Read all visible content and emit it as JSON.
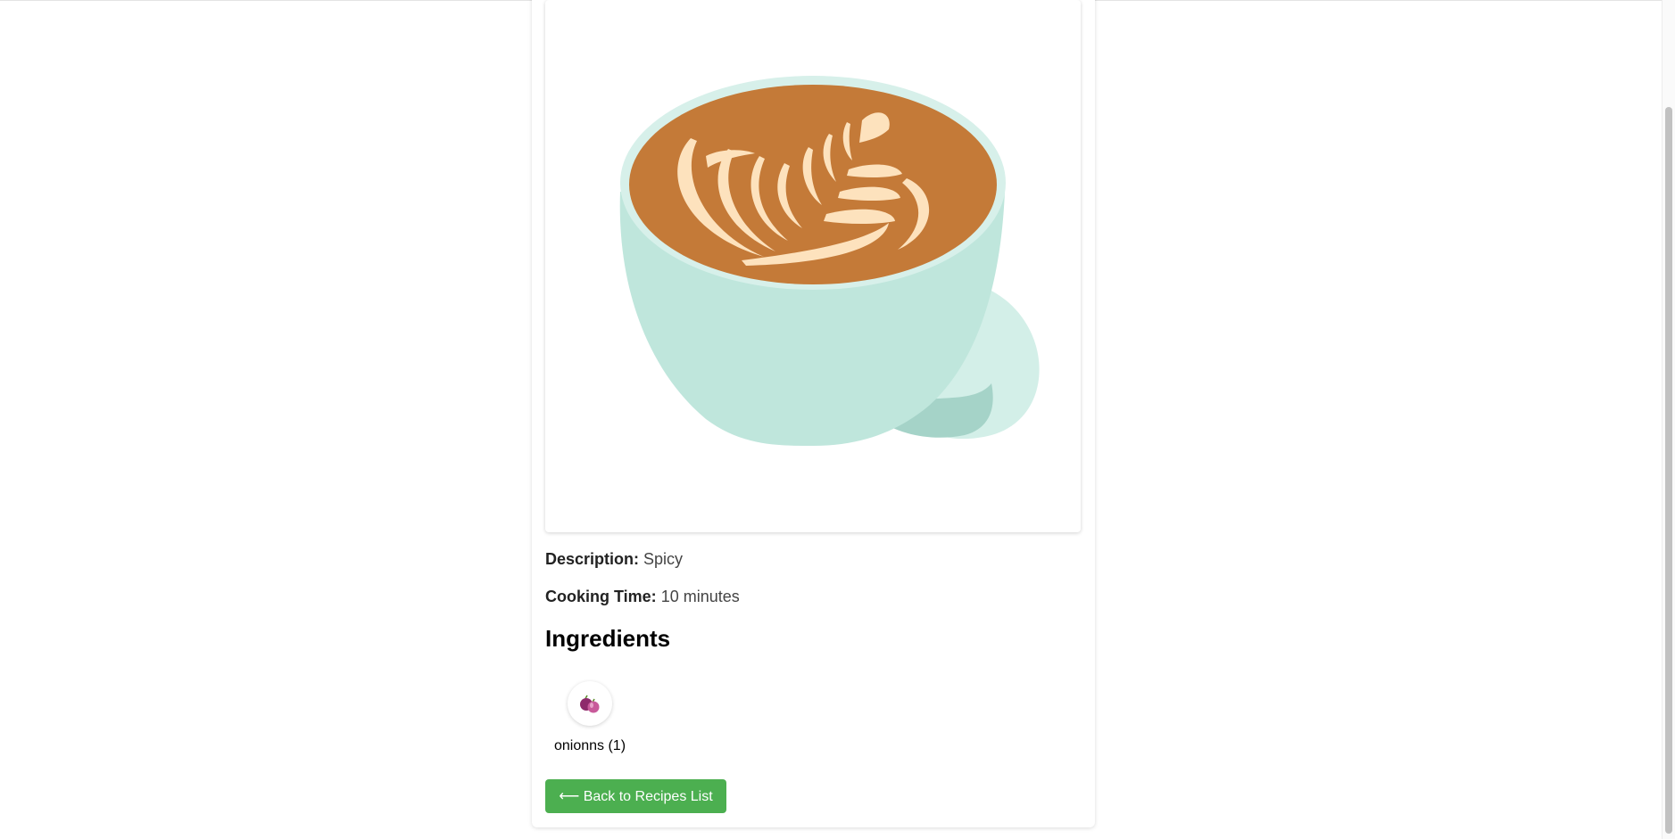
{
  "recipe": {
    "image_icon": "latte-art-coffee-cup-image",
    "description_label": "Description:",
    "description_value": "Spicy",
    "cooking_time_label": "Cooking Time:",
    "cooking_time_value": "10 minutes"
  },
  "ingredients_section": {
    "heading": "Ingredients",
    "items": [
      {
        "icon": "onion-icon",
        "label": "onionns (1)"
      }
    ]
  },
  "actions": {
    "back_label": "⟵ Back to Recipes List"
  },
  "colors": {
    "accent_button": "#4caf50",
    "cup": "#bfe6dc",
    "coffee": "#c47a38",
    "foam": "#fde2bd"
  }
}
